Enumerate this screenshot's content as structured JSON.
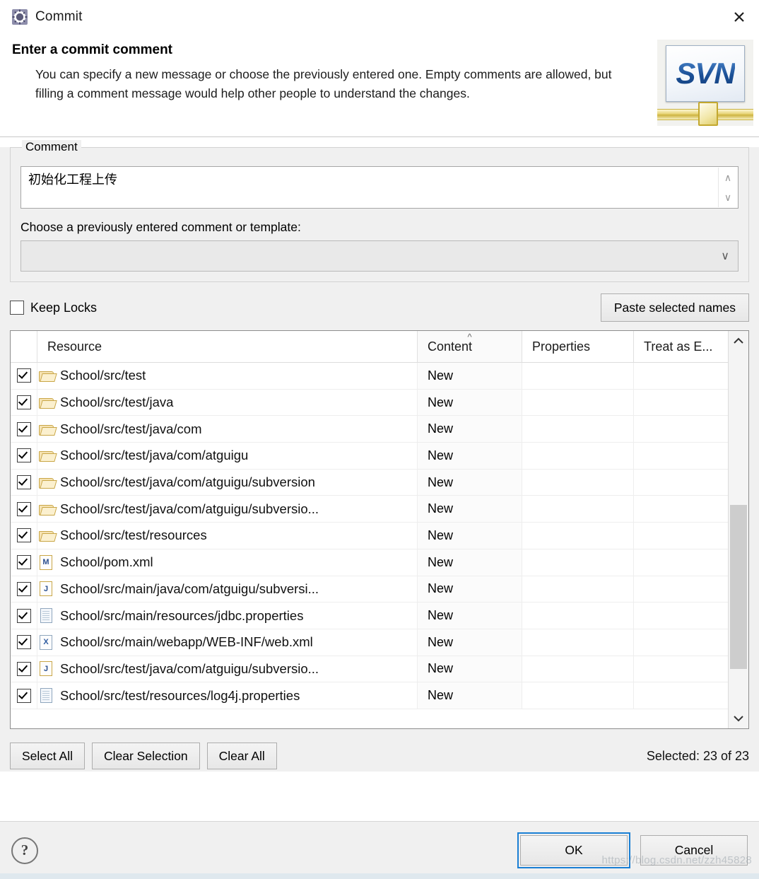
{
  "window": {
    "title": "Commit",
    "title_icon": "svn-commit-icon",
    "close_icon": "close-icon"
  },
  "header": {
    "title": "Enter a commit comment",
    "description": "You can specify a new message or choose the previously entered one. Empty comments are allowed, but filling a comment message would help other people to understand the changes.",
    "logo_text": "SVN",
    "logo_icon": "svn-banner-logo"
  },
  "comment_group": {
    "label": "Comment",
    "textarea_value": "初始化工程上传",
    "textarea_placeholder": "",
    "scroll_up_icon": "chevron-up-icon",
    "scroll_down_icon": "chevron-down-icon",
    "choose_label": "Choose a previously entered comment or template:",
    "combo_value": "",
    "combo_arrow_icon": "chevron-down-icon",
    "combo_options": []
  },
  "locks": {
    "checkbox_label": "Keep Locks",
    "checked": false,
    "paste_button": "Paste selected names"
  },
  "table": {
    "columns": [
      "Resource",
      "Content",
      "Properties",
      "Treat as E..."
    ],
    "sorted_column": "Content",
    "sort_caret_icon": "caret-up-icon",
    "rows": [
      {
        "checked": true,
        "icon": "folder-icon",
        "resource": "School/src/test",
        "content": "New",
        "properties": "",
        "treat_as": ""
      },
      {
        "checked": true,
        "icon": "folder-icon",
        "resource": "School/src/test/java",
        "content": "New",
        "properties": "",
        "treat_as": ""
      },
      {
        "checked": true,
        "icon": "folder-icon",
        "resource": "School/src/test/java/com",
        "content": "New",
        "properties": "",
        "treat_as": ""
      },
      {
        "checked": true,
        "icon": "folder-icon",
        "resource": "School/src/test/java/com/atguigu",
        "content": "New",
        "properties": "",
        "treat_as": ""
      },
      {
        "checked": true,
        "icon": "folder-icon",
        "resource": "School/src/test/java/com/atguigu/subversion",
        "content": "New",
        "properties": "",
        "treat_as": ""
      },
      {
        "checked": true,
        "icon": "folder-icon",
        "resource": "School/src/test/java/com/atguigu/subversio...",
        "content": "New",
        "properties": "",
        "treat_as": ""
      },
      {
        "checked": true,
        "icon": "folder-icon",
        "resource": "School/src/test/resources",
        "content": "New",
        "properties": "",
        "treat_as": ""
      },
      {
        "checked": true,
        "icon": "maven-file-icon",
        "resource": "School/pom.xml",
        "content": "New",
        "properties": "",
        "treat_as": ""
      },
      {
        "checked": true,
        "icon": "java-file-icon",
        "resource": "School/src/main/java/com/atguigu/subversi...",
        "content": "New",
        "properties": "",
        "treat_as": ""
      },
      {
        "checked": true,
        "icon": "text-file-icon",
        "resource": "School/src/main/resources/jdbc.properties",
        "content": "New",
        "properties": "",
        "treat_as": ""
      },
      {
        "checked": true,
        "icon": "xml-file-icon",
        "resource": "School/src/main/webapp/WEB-INF/web.xml",
        "content": "New",
        "properties": "",
        "treat_as": ""
      },
      {
        "checked": true,
        "icon": "java-file-icon",
        "resource": "School/src/test/java/com/atguigu/subversio...",
        "content": "New",
        "properties": "",
        "treat_as": ""
      },
      {
        "checked": true,
        "icon": "text-file-icon",
        "resource": "School/src/test/resources/log4j.properties",
        "content": "New",
        "properties": "",
        "treat_as": ""
      }
    ],
    "scrollbar": {
      "up_icon": "chevron-up-icon",
      "down_icon": "chevron-down-icon"
    }
  },
  "selection_bar": {
    "select_all": "Select All",
    "clear_selection": "Clear Selection",
    "clear_all": "Clear All",
    "status": "Selected: 23 of 23"
  },
  "footer": {
    "help_icon": "help-icon",
    "help_glyph": "?",
    "ok": "OK",
    "cancel": "Cancel",
    "watermark": "https://blog.csdn.net/zzh45828"
  },
  "icon_glyphs": {
    "chevron_up": "∧",
    "chevron_down": "∨",
    "close": "✕",
    "caret_up": "^"
  },
  "colors": {
    "dialog_bg": "#f0f0f0",
    "accent_focus": "#1a7fd4",
    "folder": "#f6e3b4",
    "svn_blue": "#1a4f96",
    "svn_gold": "#cdb33f"
  }
}
